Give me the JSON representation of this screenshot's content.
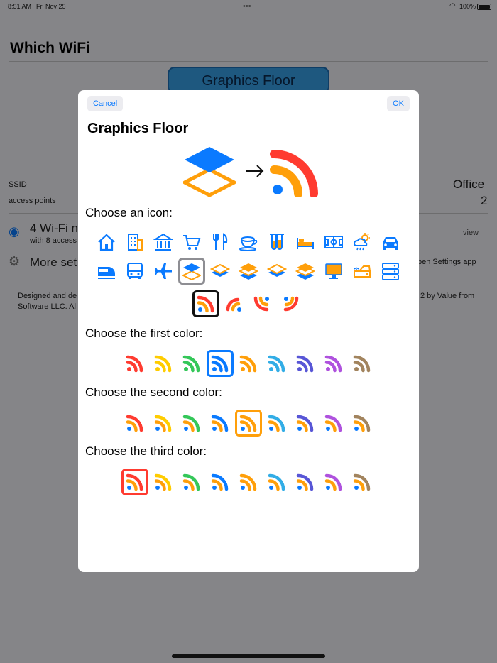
{
  "status_bar": {
    "time": "8:51 AM",
    "date": "Fri Nov 25",
    "battery": "100%"
  },
  "background": {
    "title": "Which WiFi",
    "banner": "Graphics Floor",
    "ssid_label": "SSID",
    "ssid_value": "Office",
    "ap_label": "access points",
    "ap_value": "2",
    "wifi_row_title": "4 Wi-Fi n",
    "wifi_row_sub": "with 8 access",
    "view_link": "view",
    "more_row": "More set",
    "open_settings": "pen Settings app",
    "footer_left": "Designed and de",
    "footer_left2": "Software LLC. Al",
    "footer_right": "2 by Value from"
  },
  "modal": {
    "cancel_label": "Cancel",
    "ok_label": "OK",
    "title": "Graphics Floor",
    "choose_icon_label": "Choose an icon:",
    "choose_first_label": "Choose the first color:",
    "choose_second_label": "Choose the second color:",
    "choose_third_label": "Choose the third color:"
  },
  "icon_rows": [
    [
      "house-icon",
      "office-building-icon",
      "bank-icon",
      "shopping-cart-icon",
      "fork-knife-icon",
      "coffee-cup-icon",
      "test-tubes-icon",
      "bed-icon",
      "soccer-field-icon",
      "weather-icon",
      "car-icon"
    ],
    [
      "train-icon",
      "bus-icon",
      "airplane-icon",
      "layers-icon",
      "layers-icon",
      "layers-icon",
      "layers-icon",
      "layers-icon",
      "monitor-icon",
      "router-icon",
      "server-icon"
    ]
  ],
  "selected_icon": {
    "row": 1,
    "col": 3
  },
  "wifi_styles": [
    "wifi-style-1",
    "wifi-style-2",
    "wifi-style-3",
    "wifi-style-4"
  ],
  "selected_style": 0,
  "palette": {
    "colors": [
      "#ff3b30",
      "#ffcc00",
      "#34c759",
      "#0a7aff",
      "#ff9f0a",
      "#32ade6",
      "#5856d6",
      "#af52de",
      "#a2845e"
    ],
    "first_selected": 3,
    "second_selected": 4,
    "third_selected": 0,
    "current": {
      "first": "#0a7aff",
      "second": "#ff9f0a",
      "third": "#ff3b30"
    }
  }
}
